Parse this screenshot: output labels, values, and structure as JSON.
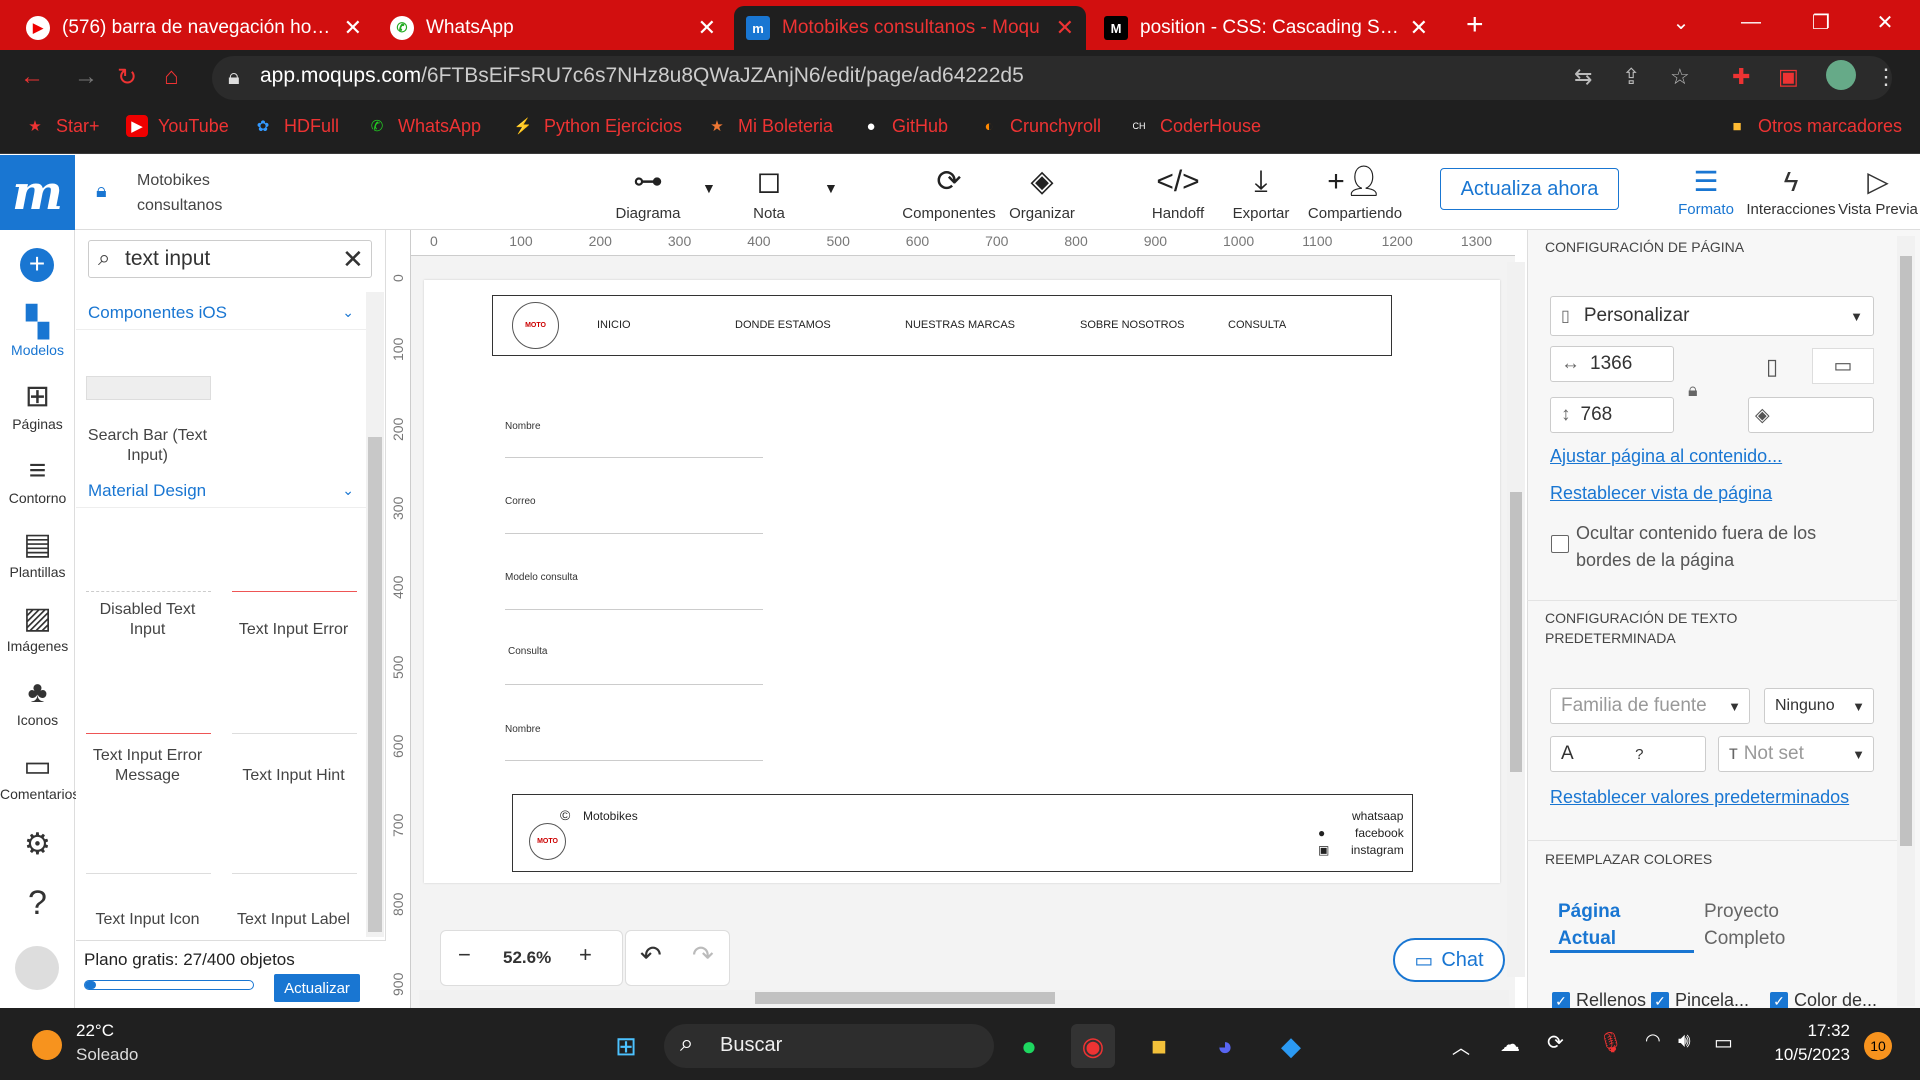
{
  "browser": {
    "tabs": [
      {
        "title": "(576) barra de navegación horizo",
        "icon": "youtube-icon"
      },
      {
        "title": "WhatsApp",
        "icon": "whatsapp-icon"
      },
      {
        "title": "Motobikes consultanos - Moqu",
        "icon": "moqups-icon"
      },
      {
        "title": "position - CSS: Cascading Style S",
        "icon": "mdn-icon"
      }
    ],
    "url_host": "app.moqups.com",
    "url_path": "/6FTBsEiFsRU7c6s7NHz8u8QWaJZAnjN6/edit/page/ad64222d5",
    "bookmarks": [
      "Star+",
      "YouTube",
      "HDFull",
      "WhatsApp",
      "Python Ejercicios",
      "Mi Boleteria",
      "GitHub",
      "Crunchyroll",
      "CoderHouse"
    ],
    "other_bookmarks": "Otros marcadores"
  },
  "app": {
    "project_line1": "Motobikes",
    "project_line2": "consultanos",
    "tools": [
      "Diagrama",
      "Nota",
      "Componentes",
      "Organizar",
      "Handoff",
      "Exportar",
      "Compartiendo"
    ],
    "update_label": "Actualiza ahora",
    "right_tools": [
      "Formato",
      "Interacciones",
      "Vista Previa"
    ]
  },
  "rail": [
    "Modelos",
    "Páginas",
    "Contorno",
    "Plantillas",
    "Imágenes",
    "Iconos",
    "Comentarios"
  ],
  "panel": {
    "search_value": "text input",
    "section_ios": "Componentes iOS",
    "section_material": "Material Design",
    "cards": [
      "Search Bar (Text Input)",
      "Disabled Text Input",
      "Text Input Error",
      "Text Input Error Message",
      "Text Input Hint",
      "Text Input Icon",
      "Text Input Label"
    ],
    "plan_text": "Plano gratis: 27/400 objetos",
    "plan_progress": 0.0675,
    "plan_button": "Actualizar"
  },
  "canvas": {
    "ruler_h": [
      "0",
      "100",
      "200",
      "300",
      "400",
      "500",
      "600",
      "700",
      "800",
      "900",
      "1000",
      "1100",
      "1200",
      "1300"
    ],
    "ruler_v": [
      "0",
      "100",
      "200",
      "300",
      "400",
      "500",
      "600",
      "700",
      "800",
      "900"
    ],
    "nav": [
      "INICIO",
      "DONDE ESTAMOS",
      "NUESTRAS MARCAS",
      "SOBRE NOSOTROS",
      "CONSULTA"
    ],
    "form_labels": [
      "Nombre",
      "Correo",
      "Modelo consulta",
      "Consulta",
      "Nombre"
    ],
    "footer_brand": "Motobikes",
    "footer_links": [
      "whatsaap",
      "facebook",
      "instagram"
    ],
    "zoom": "52.6%",
    "chat": "Chat"
  },
  "format": {
    "page_config": "CONFIGURACIÓN DE PÁGINA",
    "preset": "Personalizar",
    "width": "1366",
    "height": "768",
    "fit_link": "Ajustar página al contenido...",
    "reset_link": "Restablecer vista de página",
    "hide_label": "Ocultar contenido fuera de los bordes de la página",
    "text_config": "CONFIGURACIÓN DE TEXTO PREDETERMINADA",
    "font_family_placeholder": "Familia de fuente",
    "font_style": "Ninguno",
    "font_size": "?",
    "line_height": "Not set",
    "reset_defaults": "Restablecer valores predeterminados",
    "replace_colors": "REEMPLAZAR COLORES",
    "scope_tabs": [
      "Página Actual",
      "Proyecto Completo"
    ],
    "checks": [
      "Rellenos",
      "Pincela...",
      "Color de..."
    ]
  },
  "taskbar": {
    "temp": "22°C",
    "weather": "Soleado",
    "search": "Buscar",
    "time": "17:32",
    "date": "10/5/2023",
    "badge": "10"
  },
  "colors": {
    "brand": "#1976d2",
    "chrome_red": "#d20f0f"
  }
}
